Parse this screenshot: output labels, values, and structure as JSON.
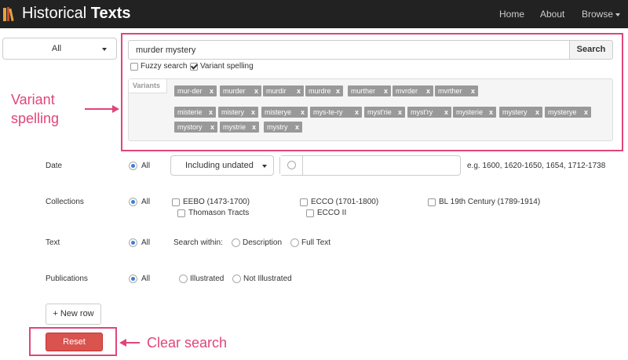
{
  "app": {
    "brand_light": "Historical ",
    "brand_bold": "Texts"
  },
  "nav": {
    "home": "Home",
    "about": "About",
    "browse": "Browse"
  },
  "scope_select": {
    "value": "All"
  },
  "search": {
    "query": "murder mystery",
    "button": "Search",
    "fuzzy_label": "Fuzzy search",
    "fuzzy_checked": false,
    "variant_label": "Variant spelling",
    "variant_checked": true
  },
  "variants": {
    "label": "Variants",
    "chips": [
      "mur-der",
      "murder",
      "murdir",
      "murdre",
      "murther",
      "mvrder",
      "mvrther",
      "misterie",
      "mistery",
      "misterye",
      "mys-te-ry",
      "myst'rie",
      "myst'ry",
      "mysterie",
      "mystery",
      "mysterye",
      "mystory",
      "mystrie",
      "mystry"
    ],
    "remove_glyph": "x"
  },
  "annotations": {
    "variant": [
      "Variant",
      "spelling"
    ],
    "clear": "Clear search"
  },
  "filters": {
    "date": {
      "label": "Date",
      "all": "All",
      "dropdown": "Including undated",
      "hint": "e.g. 1600, 1620-1650, 1654, 1712-1738"
    },
    "collections": {
      "label": "Collections",
      "all": "All",
      "options": [
        "EEBO (1473-1700)",
        "ECCO (1701-1800)",
        "BL 19th Century (1789-1914)",
        "Thomason Tracts",
        "ECCO II"
      ]
    },
    "text": {
      "label": "Text",
      "all": "All",
      "search_within": "Search within:",
      "options": [
        "Description",
        "Full Text"
      ]
    },
    "publications": {
      "label": "Publications",
      "all": "All",
      "options": [
        "Illustrated",
        "Not Illustrated"
      ]
    }
  },
  "buttons": {
    "new_row": "+ New row",
    "reset": "Reset"
  },
  "colors": {
    "navbar": "#222222",
    "highlight": "#e0457b",
    "reset": "#d9534f",
    "chip": "#999999",
    "radio_on": "#3a7ed8"
  }
}
